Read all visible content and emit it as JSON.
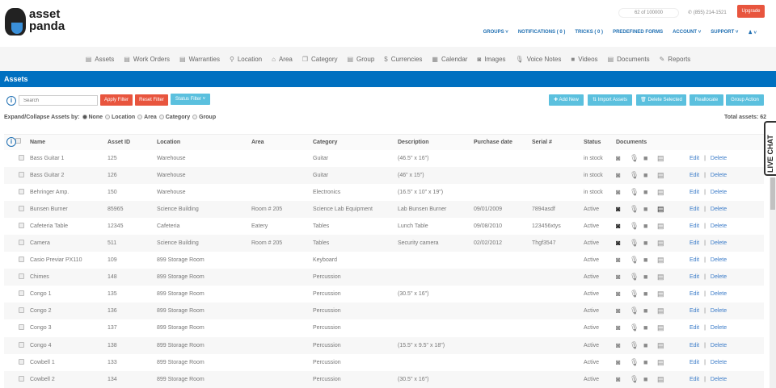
{
  "brand": {
    "line1": "asset",
    "line2": "panda"
  },
  "header": {
    "counter": "62 of 100000",
    "phone": "(855) 214-1521",
    "upgrade": "Upgrade",
    "nav": [
      "GROUPS ˅",
      "NOTIFICATIONS ( 0 )",
      "TRICKS ( 0 )",
      "PREDEFINED FORMS",
      "ACCOUNT ˅",
      "SUPPORT ˅",
      "♟ ˅"
    ]
  },
  "modules": [
    {
      "icon": "▤",
      "label": "Assets"
    },
    {
      "icon": "▤",
      "label": "Work Orders"
    },
    {
      "icon": "▤",
      "label": "Warranties"
    },
    {
      "icon": "⚲",
      "label": "Location"
    },
    {
      "icon": "⌂",
      "label": "Area"
    },
    {
      "icon": "❐",
      "label": "Category"
    },
    {
      "icon": "▤",
      "label": "Group"
    },
    {
      "icon": "$",
      "label": "Currencies"
    },
    {
      "icon": "▦",
      "label": "Calendar"
    },
    {
      "icon": "◙",
      "label": "Images"
    },
    {
      "icon": "🎙",
      "label": "Voice Notes"
    },
    {
      "icon": "■",
      "label": "Videos"
    },
    {
      "icon": "▤",
      "label": "Documents"
    },
    {
      "icon": "✎",
      "label": "Reports"
    }
  ],
  "page_title": "Assets",
  "toolbar": {
    "search_placeholder": "Search",
    "apply": "Apply Filter",
    "reset": "Reset Filter",
    "status": "Status Filter ˅",
    "add": "✚ Add New",
    "import": "⇅ Import Assets",
    "delete": "🗑 Delete Selected",
    "reallocate": "Reallocate",
    "group_action": "Group Action"
  },
  "expand": {
    "label": "Expand/Collapse Assets by:",
    "options": [
      "None",
      "Location",
      "Area",
      "Category",
      "Group"
    ],
    "selected": "None"
  },
  "total": "Total assets: 62",
  "columns": [
    "Name",
    "Asset ID",
    "Location",
    "Area",
    "Category",
    "Description",
    "Purchase date",
    "Serial #",
    "Status",
    "Documents"
  ],
  "actions": {
    "edit": "Edit",
    "sep": "|",
    "delete": "Delete"
  },
  "rows": [
    [
      "Bass Guitar 1",
      "125",
      "Warehouse",
      "",
      "Guitar",
      "(46.5\" x 16\")",
      "",
      "",
      "in stock",
      0
    ],
    [
      "Bass Guitar 2",
      "126",
      "Warehouse",
      "",
      "Guitar",
      "(46\" x 15\")",
      "",
      "",
      "in stock",
      0
    ],
    [
      "Behringer Amp.",
      "150",
      "Warehouse",
      "",
      "Electronics",
      "(16.5\" x 10\" x 19\")",
      "",
      "",
      "in stock",
      0
    ],
    [
      "Bunsen Burner",
      "85965",
      "Science Building",
      "Room # 205",
      "Science Lab Equipment",
      "Lab Bunsen Burner",
      "09/01/2009",
      "7894asdf",
      "Active",
      2
    ],
    [
      "Cafeteria Table",
      "12345",
      "Cafeteria",
      "Eatery",
      "Tables",
      "Lunch Table",
      "09/08/2010",
      "123456xtys",
      "Active",
      1
    ],
    [
      "Camera",
      "511",
      "Science Building",
      "Room # 205",
      "Tables",
      "Security camera",
      "02/02/2012",
      "Thgf3547",
      "Active",
      1
    ],
    [
      "Casio Previar PX110",
      "109",
      "899 Storage Room",
      "",
      "Keyboard",
      "",
      "",
      "",
      "Active",
      0
    ],
    [
      "Chimes",
      "148",
      "899 Storage Room",
      "",
      "Percussion",
      "",
      "",
      "",
      "Active",
      0
    ],
    [
      "Congo 1",
      "135",
      "899 Storage Room",
      "",
      "Percussion",
      "(30.5\" x 16\")",
      "",
      "",
      "Active",
      0
    ],
    [
      "Congo 2",
      "136",
      "899 Storage Room",
      "",
      "Percussion",
      "",
      "",
      "",
      "Active",
      0
    ],
    [
      "Congo 3",
      "137",
      "899 Storage Room",
      "",
      "Percussion",
      "",
      "",
      "",
      "Active",
      0
    ],
    [
      "Congo 4",
      "138",
      "899 Storage Room",
      "",
      "Percussion",
      "(15.5\" x 9.5\" x 18\")",
      "",
      "",
      "Active",
      0
    ],
    [
      "Cowbell 1",
      "133",
      "899 Storage Room",
      "",
      "Percussion",
      "",
      "",
      "",
      "Active",
      0
    ],
    [
      "Cowbell 2",
      "134",
      "899 Storage Room",
      "",
      "Percussion",
      "(30.5\" x 16\")",
      "",
      "",
      "Active",
      0
    ]
  ],
  "live_chat": "LIVE CHAT",
  "colors": {
    "primary": "#0070c0",
    "danger": "#e8553e",
    "info": "#5bc0de",
    "link": "#3a7bc8"
  }
}
